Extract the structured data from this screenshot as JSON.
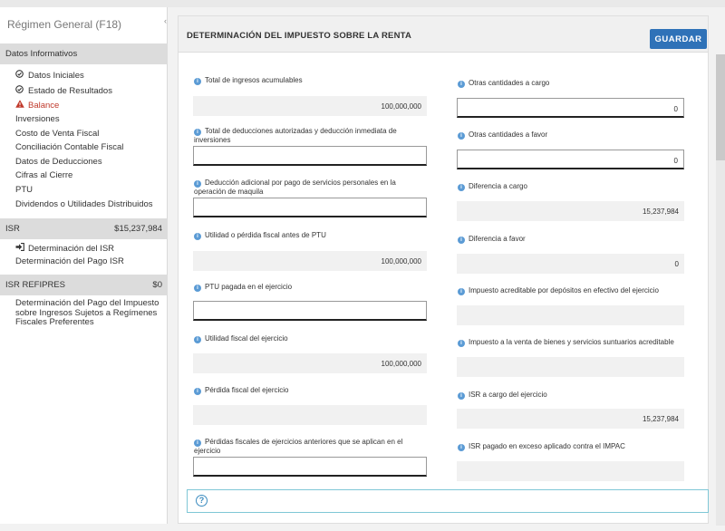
{
  "sidebar": {
    "title": "Régimen General (F18)",
    "datos_informativos": {
      "header": "Datos Informativos",
      "items": [
        {
          "label": "Datos Iniciales",
          "icon": "check-circle-icon"
        },
        {
          "label": "Estado de Resultados",
          "icon": "check-circle-icon"
        },
        {
          "label": "Balance",
          "icon": "warning-icon"
        },
        {
          "label": "Inversiones"
        },
        {
          "label": "Costo de Venta Fiscal"
        },
        {
          "label": "Conciliación Contable Fiscal"
        },
        {
          "label": "Datos de Deducciones"
        },
        {
          "label": "Cifras al Cierre"
        },
        {
          "label": "PTU"
        },
        {
          "label": "Dividendos o Utilidades Distribuidos"
        }
      ]
    },
    "isr": {
      "header": "ISR",
      "amount": "$15,237,984",
      "items": [
        {
          "label": "Determinación del ISR",
          "icon": "sign-in-icon"
        },
        {
          "label": "Determinación del Pago ISR"
        }
      ]
    },
    "isr_refipres": {
      "header": "ISR REFIPRES",
      "amount": "$0",
      "items": [
        {
          "label": "Determinación del Pago del Impuesto sobre Ingresos Sujetos a Regímenes Fiscales Preferentes"
        }
      ]
    }
  },
  "main": {
    "title": "DETERMINACIÓN DEL IMPUESTO SOBRE LA RENTA",
    "save_label": "GUARDAR",
    "left_fields": [
      {
        "label": "Total de ingresos acumulables",
        "value": "100,000,000"
      },
      {
        "label": "Total de deducciones autorizadas y deducción inmediata de inversiones",
        "value": ""
      },
      {
        "label": "Deducción adicional por pago de servicios personales en la operación de maquila",
        "value": ""
      },
      {
        "label": "Utilidad o pérdida fiscal antes de PTU",
        "value": "100,000,000"
      },
      {
        "label": "PTU pagada en el ejercicio",
        "value": ""
      },
      {
        "label": "Utilidad fiscal del ejercicio",
        "value": "100,000,000"
      },
      {
        "label": "Pérdida fiscal del ejercicio",
        "value": ""
      },
      {
        "label": "Pérdidas fiscales de ejercicios anteriores que se aplican en el ejercicio",
        "value": ""
      }
    ],
    "right_fields": [
      {
        "label": "Otras cantidades a cargo",
        "value": "0"
      },
      {
        "label": "Otras cantidades a favor",
        "value": "0"
      },
      {
        "label": "Diferencia a cargo",
        "value": "15,237,984"
      },
      {
        "label": "Diferencia a favor",
        "value": "0"
      },
      {
        "label": "Impuesto acreditable por depósitos en efectivo del ejercicio",
        "value": ""
      },
      {
        "label": "Impuesto a la venta de bienes y servicios suntuarios acreditable",
        "value": ""
      },
      {
        "label": "ISR a cargo del ejercicio",
        "value": "15,237,984"
      },
      {
        "label": "ISR pagado en exceso aplicado contra el IMPAC",
        "value": ""
      }
    ]
  },
  "icons": {
    "info": "info-icon",
    "help": "help-icon"
  }
}
